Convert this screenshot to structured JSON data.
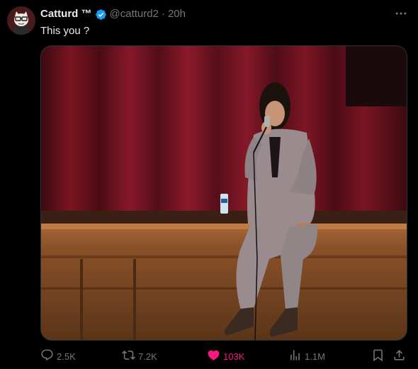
{
  "author": {
    "display_name": "Catturd ™",
    "handle": "@catturd2",
    "separator": "·",
    "time": "20h",
    "verified": true
  },
  "tweet": {
    "text": "This you ?"
  },
  "media": {
    "type": "video"
  },
  "actions": {
    "replies": "2.5K",
    "retweets": "7.2K",
    "likes": "103K",
    "views": "1.1M",
    "liked": true
  },
  "colors": {
    "background": "#000000",
    "text": "#e7e9ea",
    "muted": "#71767b",
    "verified": "#1d9bf0",
    "like": "#f91880"
  },
  "icons": {
    "more": "more-dots-icon",
    "reply": "reply-icon",
    "retweet": "retweet-icon",
    "like": "heart-icon",
    "views": "views-icon",
    "bookmark": "bookmark-icon",
    "share": "share-icon"
  }
}
